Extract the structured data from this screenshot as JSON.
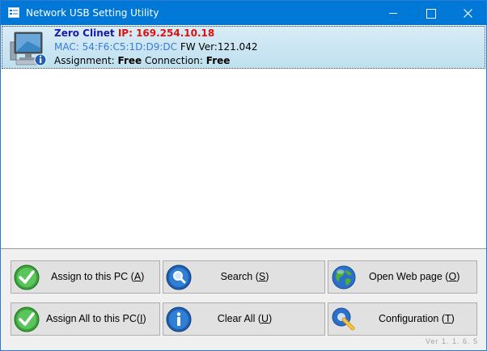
{
  "window": {
    "title": "Network USB Setting Utility"
  },
  "device": {
    "name": "Zero Clinet",
    "ip_label": "IP:",
    "ip": "169.254.10.18",
    "mac": "MAC: 54:F6:C5:1D:D9:DC",
    "fw": "FW Ver:121.042",
    "assignment_label": "Assignment:",
    "assignment": "Free",
    "connection_label": "Connection:",
    "connection": "Free"
  },
  "buttons": {
    "assign_pc": {
      "pre": "Assign to this PC (",
      "key": "A",
      "post": ")"
    },
    "search": {
      "pre": "Search (",
      "key": "S",
      "post": ")"
    },
    "open_web": {
      "pre": "Open Web page (",
      "key": "O",
      "post": ")"
    },
    "assign_all": {
      "pre": "Assign All  to this PC(",
      "key": "I",
      "post": ")"
    },
    "clear_all": {
      "pre": "Clear All (",
      "key": "U",
      "post": ")"
    },
    "configuration": {
      "pre": "Configuration (",
      "key": "T",
      "post": ")"
    }
  },
  "version": "Ver 1. 1. 6. 5",
  "icons": {
    "check": "check-icon",
    "search": "magnifier-icon",
    "web": "globe-icon",
    "info": "info-icon",
    "config": "wrench-icon"
  }
}
